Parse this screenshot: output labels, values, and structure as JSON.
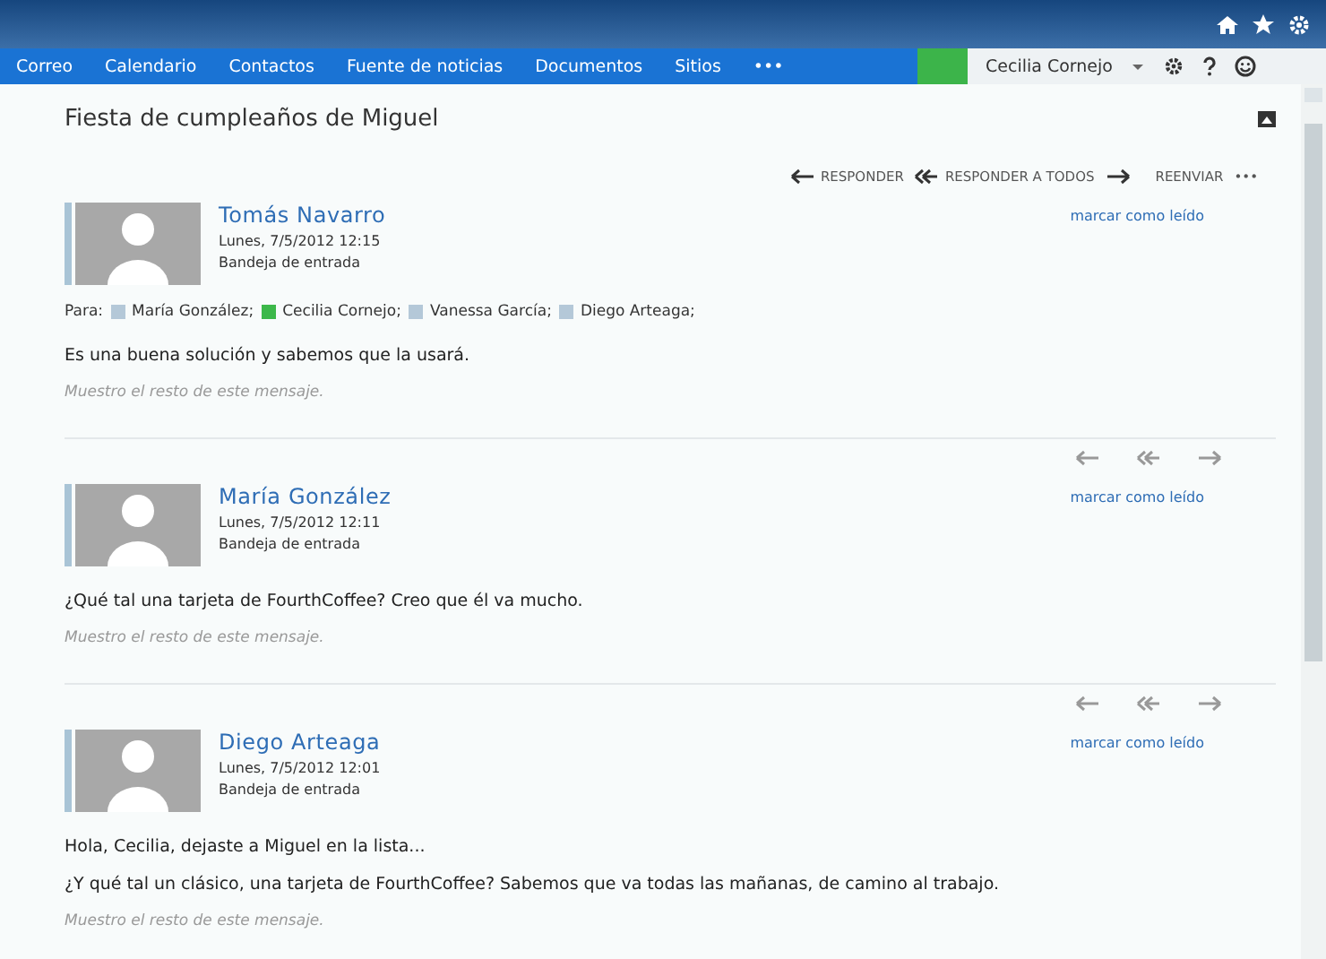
{
  "nav": {
    "items": [
      {
        "label": "Correo"
      },
      {
        "label": "Calendario"
      },
      {
        "label": "Contactos"
      },
      {
        "label": "Fuente de noticias"
      },
      {
        "label": "Documentos"
      },
      {
        "label": "Sitios"
      },
      {
        "label": "•••"
      }
    ],
    "user": "Cecilia Cornejo"
  },
  "subject": "Fiesta de cumpleaños de Miguel",
  "actions": [
    {
      "kind": "reply",
      "label": "RESPONDER"
    },
    {
      "kind": "reply_all",
      "label": "RESPONDER A TODOS"
    },
    {
      "kind": "forward",
      "label": "REENVIAR"
    },
    {
      "kind": "more",
      "label": "•••"
    }
  ],
  "messages": [
    {
      "sender": "Tomás Navarro",
      "date": "Lunes, 7/5/2012 12:15",
      "folder": "Bandeja de entrada",
      "mark_read": "marcar como leído",
      "to_label": "Para:",
      "recipients": [
        {
          "name": "María González;",
          "color": "#b4c8d8"
        },
        {
          "name": "Cecilia Cornejo;",
          "color": "#3cb84a"
        },
        {
          "name": "Vanessa García;",
          "color": "#b4c8d8"
        },
        {
          "name": "Diego Arteaga;",
          "color": "#b4c8d8"
        }
      ],
      "body": [
        "Es una buena solución y sabemos que la usará."
      ],
      "more": "Muestro el resto de este mensaje."
    },
    {
      "sender": "María González",
      "date": "Lunes, 7/5/2012 12:11",
      "folder": "Bandeja de entrada",
      "mark_read": "marcar como leído",
      "body": [
        "¿Qué tal una tarjeta de FourthCoffee? Creo que él va mucho."
      ],
      "more": "Muestro el resto de este mensaje."
    },
    {
      "sender": "Diego Arteaga",
      "date": "Lunes, 7/5/2012 12:01",
      "folder": "Bandeja de entrada",
      "mark_read": "marcar como leído",
      "body": [
        "Hola, Cecilia, dejaste a Miguel en la lista...",
        "¿Y qué tal un clásico, una tarjeta de FourthCoffee? Sabemos que va todas las mañanas, de camino al trabajo."
      ],
      "more": "Muestro el resto de este mensaje."
    }
  ]
}
